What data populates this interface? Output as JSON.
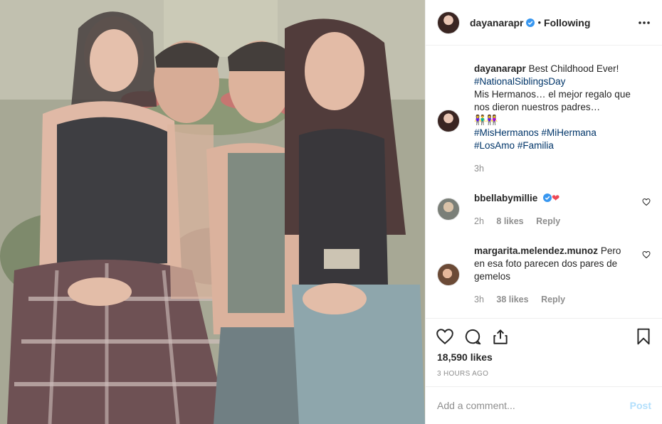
{
  "post": {
    "username": "dayanarapr",
    "follow_status": "Following",
    "separator": "•",
    "more_icon": "more-horizontal-icon",
    "photo_alt": "Four siblings sitting together in front of a garden"
  },
  "caption": {
    "username": "dayanarapr",
    "text_1": "Best Childhood Ever!",
    "hashtag_1": "#NationalSiblingsDay",
    "text_2": "Mis Hermanos… el mejor regalo que nos dieron nuestros padres…",
    "emoji": "👫👭",
    "hashtag_2": "#MisHermanos",
    "hashtag_3": "#MiHermana",
    "hashtag_4": "#LosAmo",
    "hashtag_5": "#Familia",
    "time": "3h"
  },
  "comments": [
    {
      "username": "bbellabymillie",
      "text": "❤",
      "time": "2h",
      "likes": "8 likes",
      "reply": "Reply"
    },
    {
      "username": "margarita.melendez.munoz",
      "text": "Pero en esa foto parecen dos pares de gemelos",
      "time": "3h",
      "likes": "38 likes",
      "reply": "Reply"
    }
  ],
  "actions": {
    "like_icon": "heart-icon",
    "comment_icon": "comment-icon",
    "share_icon": "share-icon",
    "save_icon": "bookmark-icon",
    "likes_count": "18,590 likes",
    "timestamp": "3 HOURS AGO"
  },
  "add_comment": {
    "placeholder": "Add a comment...",
    "post_label": "Post"
  },
  "colors": {
    "link": "#003569",
    "verified": "#3897f0",
    "muted": "#8e8e8e",
    "post_disabled": "#b2dffc"
  }
}
